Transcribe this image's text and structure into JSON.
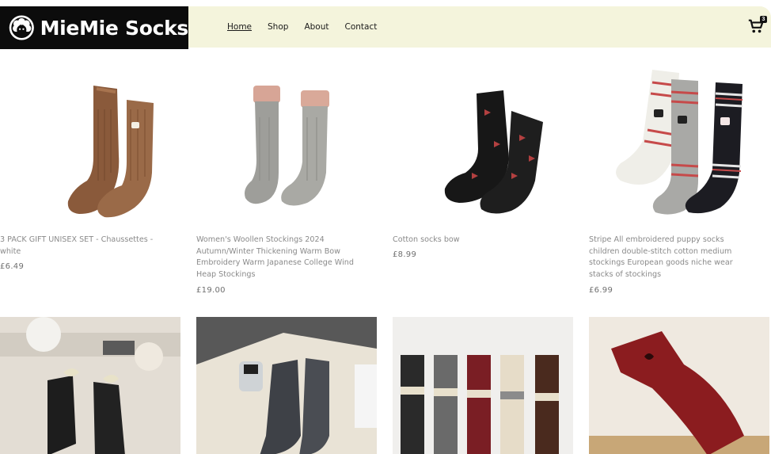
{
  "brand": {
    "name": "MieMie Socks",
    "logo_icon": "sheep-icon"
  },
  "nav": [
    {
      "label": "Home",
      "active": true
    },
    {
      "label": "Shop",
      "active": false
    },
    {
      "label": "About",
      "active": false
    },
    {
      "label": "Contact",
      "active": false
    }
  ],
  "cart": {
    "icon": "cart-icon",
    "count": "3"
  },
  "products": [
    {
      "name": "3 PACK GIFT UNISEX SET - Chaussettes - white",
      "price": "£6.49"
    },
    {
      "name": "Women's Woollen Stockings 2024 Autumn/Winter Thickening Warm Bow Embroidery Warm Japanese College Wind Heap Stockings",
      "price": "£19.00"
    },
    {
      "name": "Cotton socks bow",
      "price": "£8.99"
    },
    {
      "name": "Stripe All embroidered puppy socks children double-stitch cotton medium stockings European goods niche wear stacks of stockings",
      "price": "£6.99"
    }
  ],
  "colors": {
    "header_bg": "#f4f4dc",
    "logo_bg": "#0c0c0c"
  }
}
